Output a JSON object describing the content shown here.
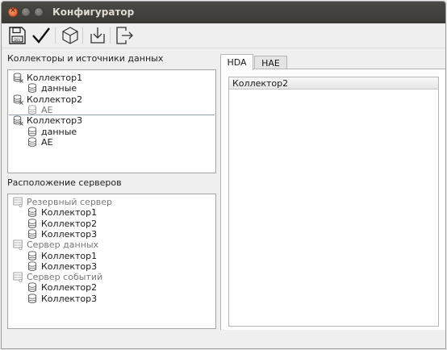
{
  "window": {
    "title": "Конфигуратор"
  },
  "toolbar": {
    "buttons": [
      {
        "name": "save-icon"
      },
      {
        "name": "apply-check-icon"
      },
      {
        "name": "cube-icon"
      },
      {
        "name": "import-icon"
      },
      {
        "name": "exit-icon"
      }
    ]
  },
  "collectors": {
    "label": "Коллекторы и источники данных",
    "items": [
      {
        "label": "Коллектор1",
        "level": 0,
        "grey": false
      },
      {
        "label": "данные",
        "level": 1,
        "grey": false
      },
      {
        "label": "Коллектор2",
        "level": 0,
        "grey": false
      },
      {
        "label": "AE",
        "level": 1,
        "grey": true
      },
      {
        "label": "Коллектор3",
        "level": 0,
        "grey": false
      },
      {
        "label": "данные",
        "level": 1,
        "grey": false
      },
      {
        "label": "AE",
        "level": 1,
        "grey": false
      }
    ]
  },
  "servers": {
    "label": "Расположение серверов",
    "items": [
      {
        "label": "Резервный сервер",
        "level": 0,
        "grey": true
      },
      {
        "label": "Коллектор1",
        "level": 1,
        "grey": false
      },
      {
        "label": "Коллектор2",
        "level": 1,
        "grey": false
      },
      {
        "label": "Коллектор3",
        "level": 1,
        "grey": false
      },
      {
        "label": "Сервер данных",
        "level": 0,
        "grey": true
      },
      {
        "label": "Коллектор1",
        "level": 1,
        "grey": false
      },
      {
        "label": "Коллектор3",
        "level": 1,
        "grey": false
      },
      {
        "label": "Сервер событий",
        "level": 0,
        "grey": true
      },
      {
        "label": "Коллектор2",
        "level": 1,
        "grey": false
      },
      {
        "label": "Коллектор3",
        "level": 1,
        "grey": false
      }
    ]
  },
  "tabs": [
    {
      "label": "HDA",
      "active": true
    },
    {
      "label": "HAE",
      "active": false
    }
  ],
  "hda": {
    "column_header": "Коллектор2"
  },
  "colors": {
    "titlebar": "#3b3a37",
    "close": "#e1582a",
    "selection_line": "#8fa3b8"
  }
}
